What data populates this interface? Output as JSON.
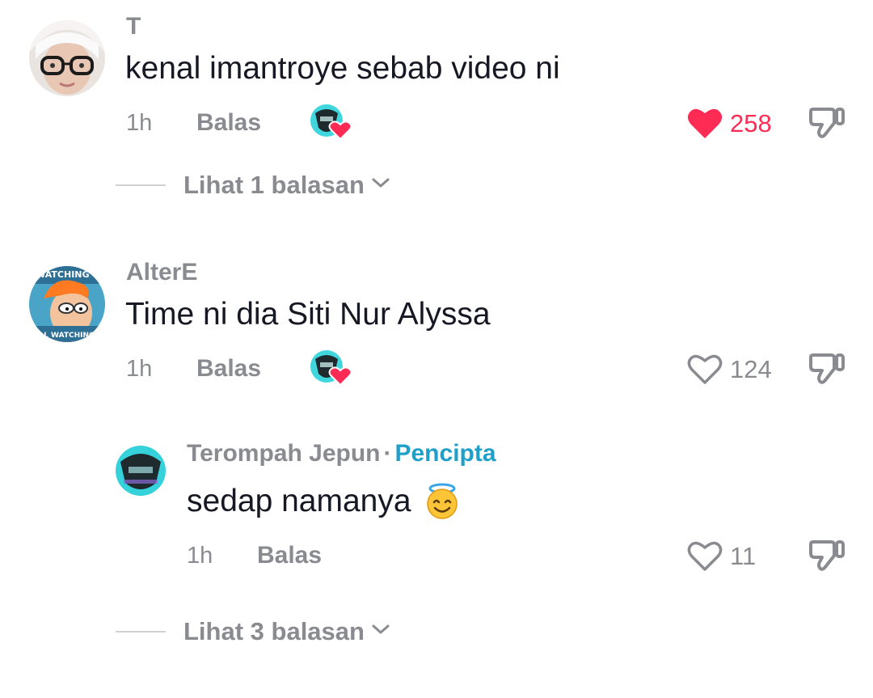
{
  "comments": [
    {
      "username": "T",
      "text": "kenal imantroye sebab video ni",
      "time": "1h",
      "reply_label": "Balas",
      "like_count": "258",
      "liked": true,
      "creator_liked": true,
      "view_replies_label": "Lihat 1 balasan"
    },
    {
      "username": "AlterE",
      "text": "Time ni dia Siti Nur Alyssa",
      "time": "1h",
      "reply_label": "Balas",
      "like_count": "124",
      "liked": false,
      "creator_liked": true,
      "avatar_caption_top": "WATCHING T",
      "avatar_caption_bottom": "TILL WATCHING Y",
      "replies": [
        {
          "username": "Terompah Jepun",
          "separator": "·",
          "creator_label": "Pencipta",
          "text": "sedap namanya",
          "emoji": "smiling-face-with-halo",
          "time": "1h",
          "reply_label": "Balas",
          "like_count": "11",
          "liked": false
        }
      ],
      "view_replies_label": "Lihat 3 balasan"
    }
  ],
  "colors": {
    "like_red": "#fe2c55",
    "muted_text": "#8a8b91",
    "primary_text": "#161823",
    "creator_blue": "#20a0c8"
  },
  "icons": {
    "like_filled": "heart-filled-icon",
    "like_outline": "heart-outline-icon",
    "dislike": "thumbs-down-icon",
    "creator_like": "creator-liked-badge-icon",
    "expand": "chevron-down-icon"
  }
}
